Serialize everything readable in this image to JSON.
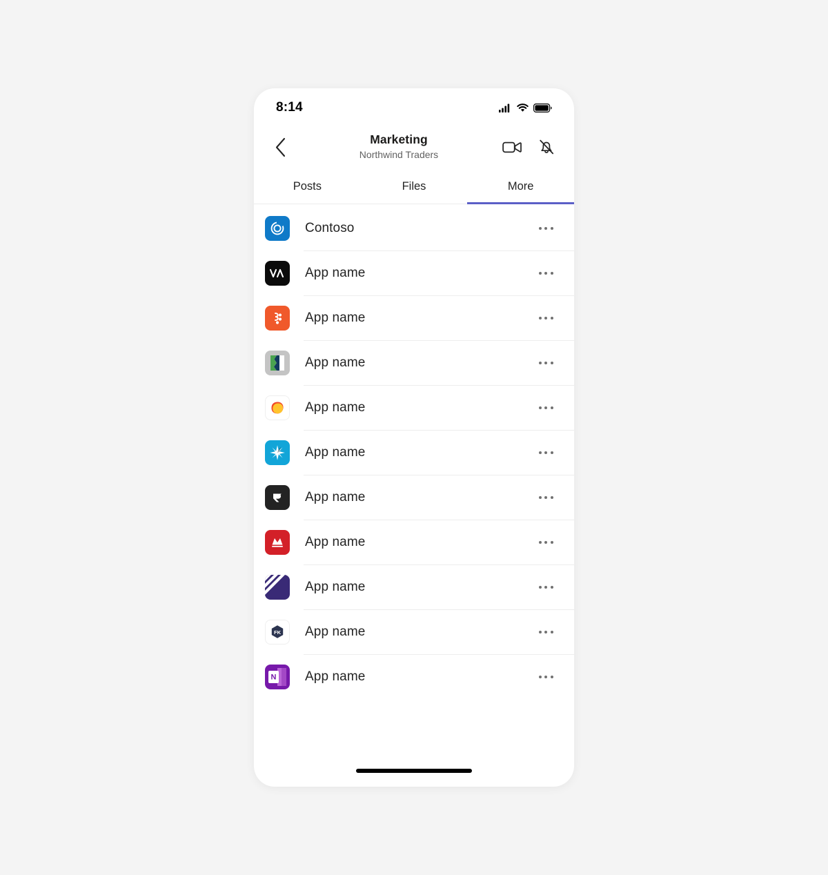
{
  "status_bar": {
    "time": "8:14",
    "cellular_icon": "cellular-bars-icon",
    "wifi_icon": "wifi-icon",
    "battery_icon": "battery-full-icon"
  },
  "header": {
    "back_icon": "chevron-left-icon",
    "title": "Marketing",
    "subtitle": "Northwind Traders",
    "video_call_icon": "video-camera-icon",
    "notifications_icon": "bell-muted-icon"
  },
  "tabs": {
    "active_index": 2,
    "items": [
      {
        "label": "Posts",
        "name": "tab-posts"
      },
      {
        "label": "Files",
        "name": "tab-files"
      },
      {
        "label": "More",
        "name": "tab-more"
      }
    ],
    "active_indicator_color": "#5b5fc7"
  },
  "app_list": {
    "overflow_icon": "more-horizontal-icon",
    "items": [
      {
        "label": "Contoso",
        "icon": "contoso-spiral-icon",
        "icon_bg": "#0f7ac8"
      },
      {
        "label": "App name",
        "icon": "black-va-monogram-icon",
        "icon_bg": "#0b0b0b"
      },
      {
        "label": "App name",
        "icon": "orange-molecule-icon",
        "icon_bg": "#f0592b"
      },
      {
        "label": "App name",
        "icon": "gray-green-flag-icon",
        "icon_bg": "#c4c4c4"
      },
      {
        "label": "App name",
        "icon": "orange-blob-icon",
        "icon_bg": "#ffffff"
      },
      {
        "label": "App name",
        "icon": "cyan-star-burst-icon",
        "icon_bg": "#12a5d8"
      },
      {
        "label": "App name",
        "icon": "dark-r-monogram-icon",
        "icon_bg": "#232323"
      },
      {
        "label": "App name",
        "icon": "red-mountain-icon",
        "icon_bg": "#d32028"
      },
      {
        "label": "App name",
        "icon": "purple-stripes-icon",
        "icon_bg": "#392a76"
      },
      {
        "label": "App name",
        "icon": "fk-hexagon-icon",
        "icon_bg": "#ffffff"
      },
      {
        "label": "App name",
        "icon": "onenote-icon",
        "icon_bg": "#7719aa"
      }
    ]
  },
  "home_indicator": {
    "name": "home-indicator"
  }
}
